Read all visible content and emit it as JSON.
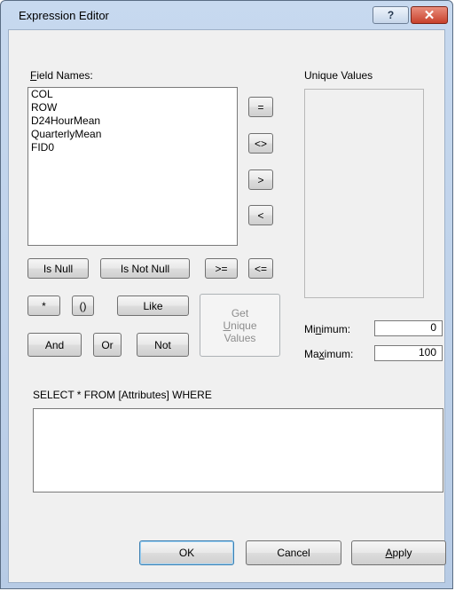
{
  "window": {
    "title": "Expression Editor",
    "help_glyph": "?",
    "close_glyph": "✕"
  },
  "fields": {
    "label_prefix": "F",
    "label_rest": "ield Names:",
    "items": [
      "COL",
      "ROW",
      "D24HourMean",
      "QuarterlyMean",
      "FID0"
    ]
  },
  "unique_values": {
    "label": "Unique Values"
  },
  "operators": {
    "eq": "=",
    "ne": "<>",
    "gt": ">",
    "lt": "<",
    "is_null": "Is Null",
    "is_not_null": "Is Not Null",
    "ge": ">=",
    "le": "<=",
    "star": "*",
    "paren": "()",
    "like": "Like",
    "and": "And",
    "or": "Or",
    "not": "Not"
  },
  "get_unique": {
    "line1": "Get",
    "line2_prefix": "U",
    "line2_rest": "nique",
    "line3": "Values"
  },
  "range": {
    "min_label_a": "Mi",
    "min_label_key": "n",
    "min_label_b": "imum:",
    "min_value": "0",
    "max_label_a": "Ma",
    "max_label_key": "x",
    "max_label_b": "imum:",
    "max_value": "100"
  },
  "query": {
    "prefix": "SELECT * FROM [Attributes] WHERE",
    "text": ""
  },
  "footer": {
    "ok": "OK",
    "cancel": "Cancel",
    "apply_prefix": "A",
    "apply_rest": "pply"
  }
}
